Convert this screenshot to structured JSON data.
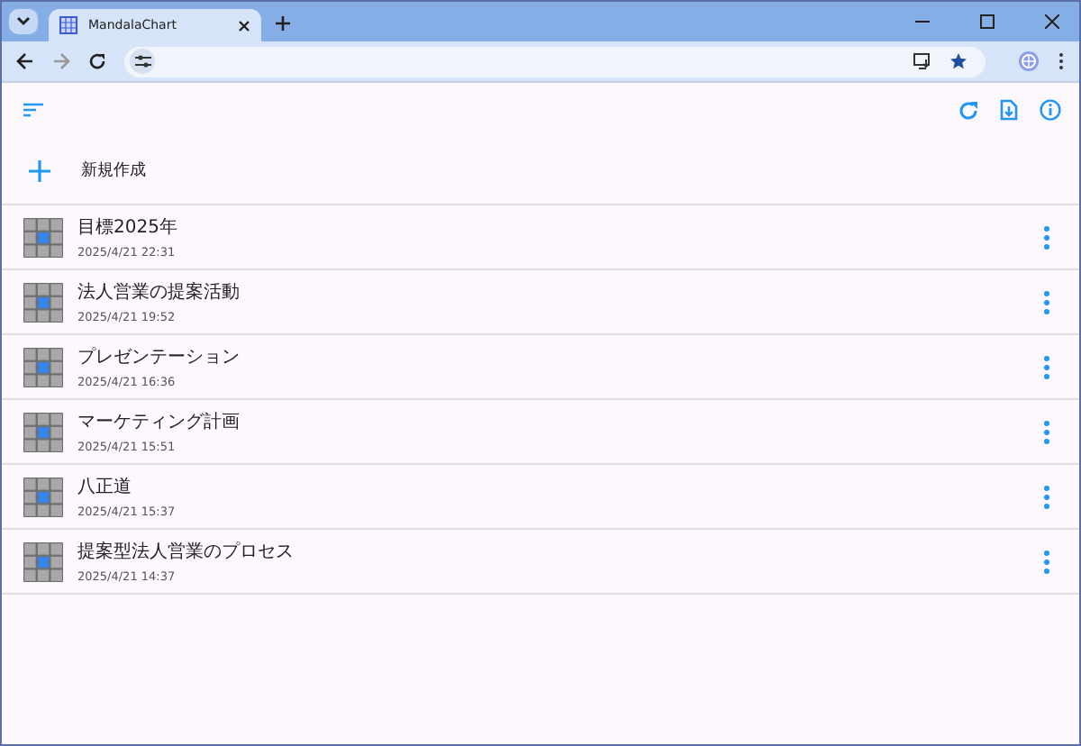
{
  "browser": {
    "tab_title": "MandalaChart"
  },
  "new_button": {
    "label": "新規作成"
  },
  "charts": [
    {
      "title": "目標2025年",
      "date": "2025/4/21 22:31"
    },
    {
      "title": "法人営業の提案活動",
      "date": "2025/4/21 19:52"
    },
    {
      "title": "プレゼンテーション",
      "date": "2025/4/21 16:36"
    },
    {
      "title": "マーケティング計画",
      "date": "2025/4/21 15:51"
    },
    {
      "title": "八正道",
      "date": "2025/4/21 15:37"
    },
    {
      "title": "提案型法人営業のプロセス",
      "date": "2025/4/21 14:37"
    }
  ]
}
